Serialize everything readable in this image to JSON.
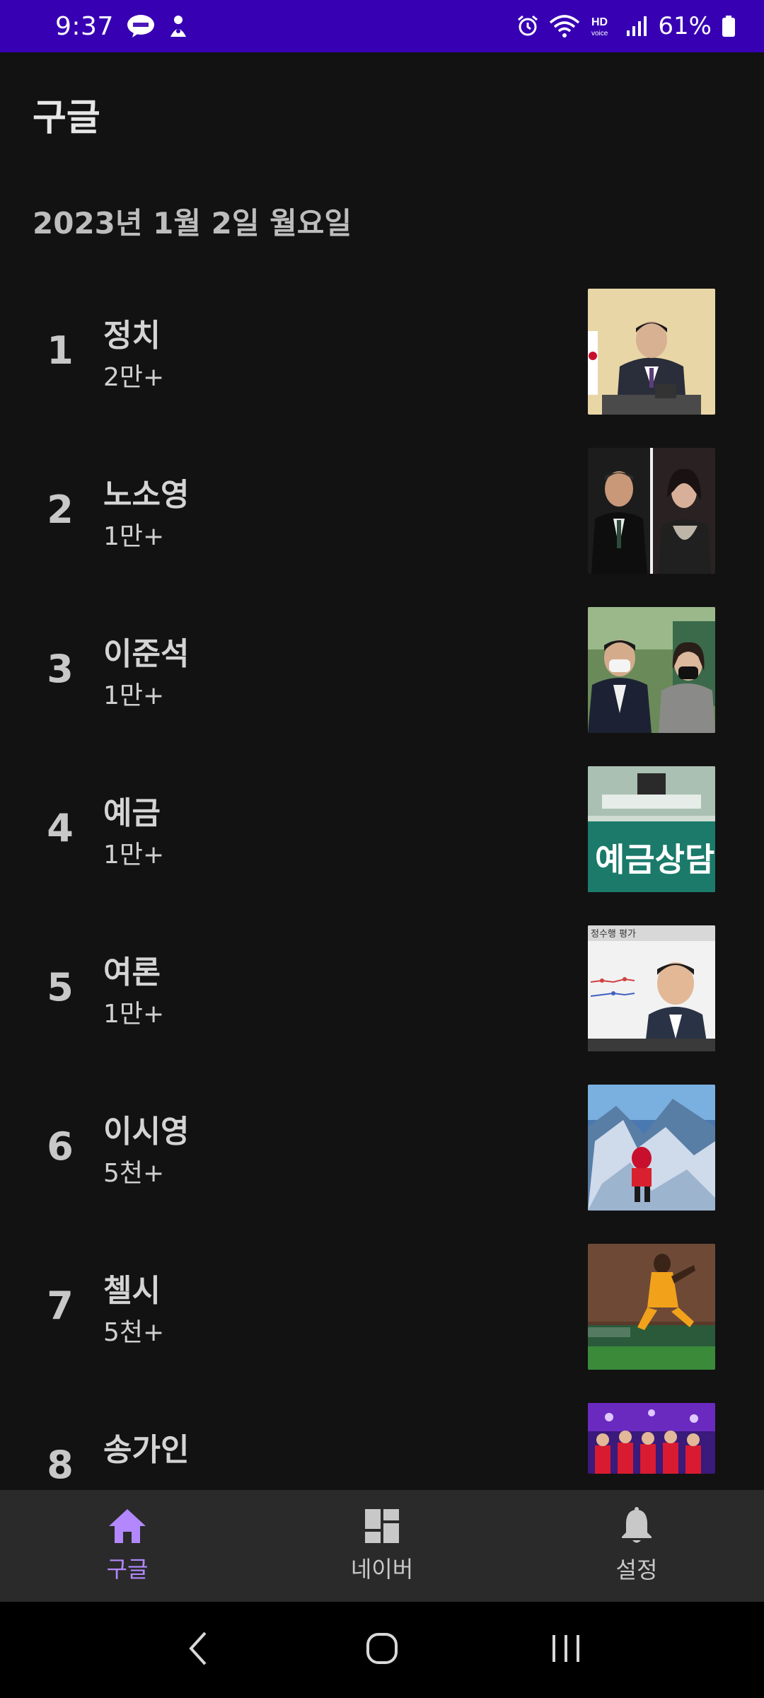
{
  "status_bar": {
    "time": "9:37",
    "battery": "61%",
    "icons_left": [
      "talk-icon",
      "assistant-icon"
    ],
    "icons_right": [
      "alarm-icon",
      "wifi-icon",
      "hd-voice-icon",
      "signal-icon",
      "battery-icon"
    ]
  },
  "header": {
    "title": "구글",
    "date": "2023년 1월 2일 월요일"
  },
  "trends": [
    {
      "rank": "1",
      "keyword": "정치",
      "count": "2만+"
    },
    {
      "rank": "2",
      "keyword": "노소영",
      "count": "1만+"
    },
    {
      "rank": "3",
      "keyword": "이준석",
      "count": "1만+"
    },
    {
      "rank": "4",
      "keyword": "예금",
      "count": "1만+"
    },
    {
      "rank": "5",
      "keyword": "여론",
      "count": "1만+"
    },
    {
      "rank": "6",
      "keyword": "이시영",
      "count": "5천+"
    },
    {
      "rank": "7",
      "keyword": "첼시",
      "count": "5천+"
    },
    {
      "rank": "8",
      "keyword": "송가인",
      "count": ""
    }
  ],
  "thumbnail_texts": {
    "deposit_sign": "예금상담",
    "poll_header": "정수행 평가"
  },
  "bottom_nav": [
    {
      "label": "구글",
      "icon": "home-icon",
      "active": true
    },
    {
      "label": "네이버",
      "icon": "dashboard-icon",
      "active": false
    },
    {
      "label": "설정",
      "icon": "bell-icon",
      "active": false
    }
  ],
  "colors": {
    "status_bar": "#3700b3",
    "background": "#121212",
    "accent": "#b388ff",
    "nav_background": "#2a2a2a"
  }
}
